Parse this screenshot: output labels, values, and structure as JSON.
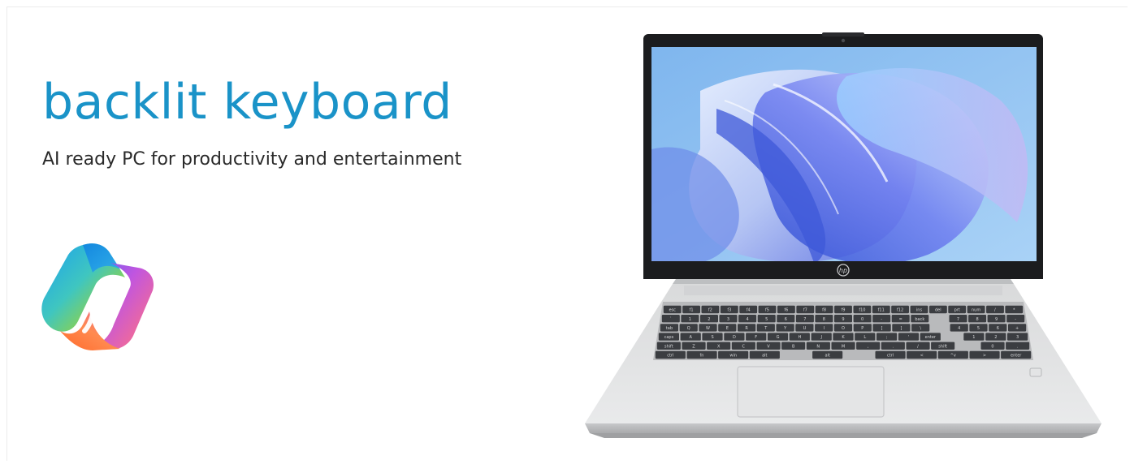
{
  "banner": {
    "headline": "backlit keyboard",
    "subheadline": "AI ready PC for productivity and entertainment",
    "logo_icon": "copilot-logo-icon",
    "product_image": "hp-laptop-image",
    "brand_mark": "hp",
    "colors": {
      "headline": "#1a93c8",
      "subheadline": "#2a2a2a",
      "background": "#ffffff"
    }
  },
  "keyboard": {
    "rows": [
      [
        "esc",
        "f1",
        "f2",
        "f3",
        "f4",
        "f5",
        "f6",
        "f7",
        "f8",
        "f9",
        "f10",
        "f11",
        "f12",
        "ins",
        "del",
        "prt",
        "num",
        "/",
        "*"
      ],
      [
        "`",
        "1",
        "2",
        "3",
        "4",
        "5",
        "6",
        "7",
        "8",
        "9",
        "0",
        "-",
        "=",
        "back",
        "",
        "7",
        "8",
        "9",
        "-"
      ],
      [
        "tab",
        "Q",
        "W",
        "E",
        "R",
        "T",
        "Y",
        "U",
        "I",
        "O",
        "P",
        "[",
        "]",
        "\\",
        "",
        "4",
        "5",
        "6",
        "+"
      ],
      [
        "caps",
        "A",
        "S",
        "D",
        "F",
        "G",
        "H",
        "J",
        "K",
        "L",
        ";",
        "'",
        "enter",
        "",
        "1",
        "2",
        "3"
      ],
      [
        "shift",
        "Z",
        "X",
        "C",
        "V",
        "B",
        "N",
        "M",
        ",",
        ".",
        "/",
        "shift",
        "",
        "0",
        "."
      ],
      [
        "ctrl",
        "fn",
        "win",
        "alt",
        "",
        "alt",
        "",
        "ctrl",
        "<",
        "^v",
        ">",
        "enter"
      ]
    ]
  }
}
